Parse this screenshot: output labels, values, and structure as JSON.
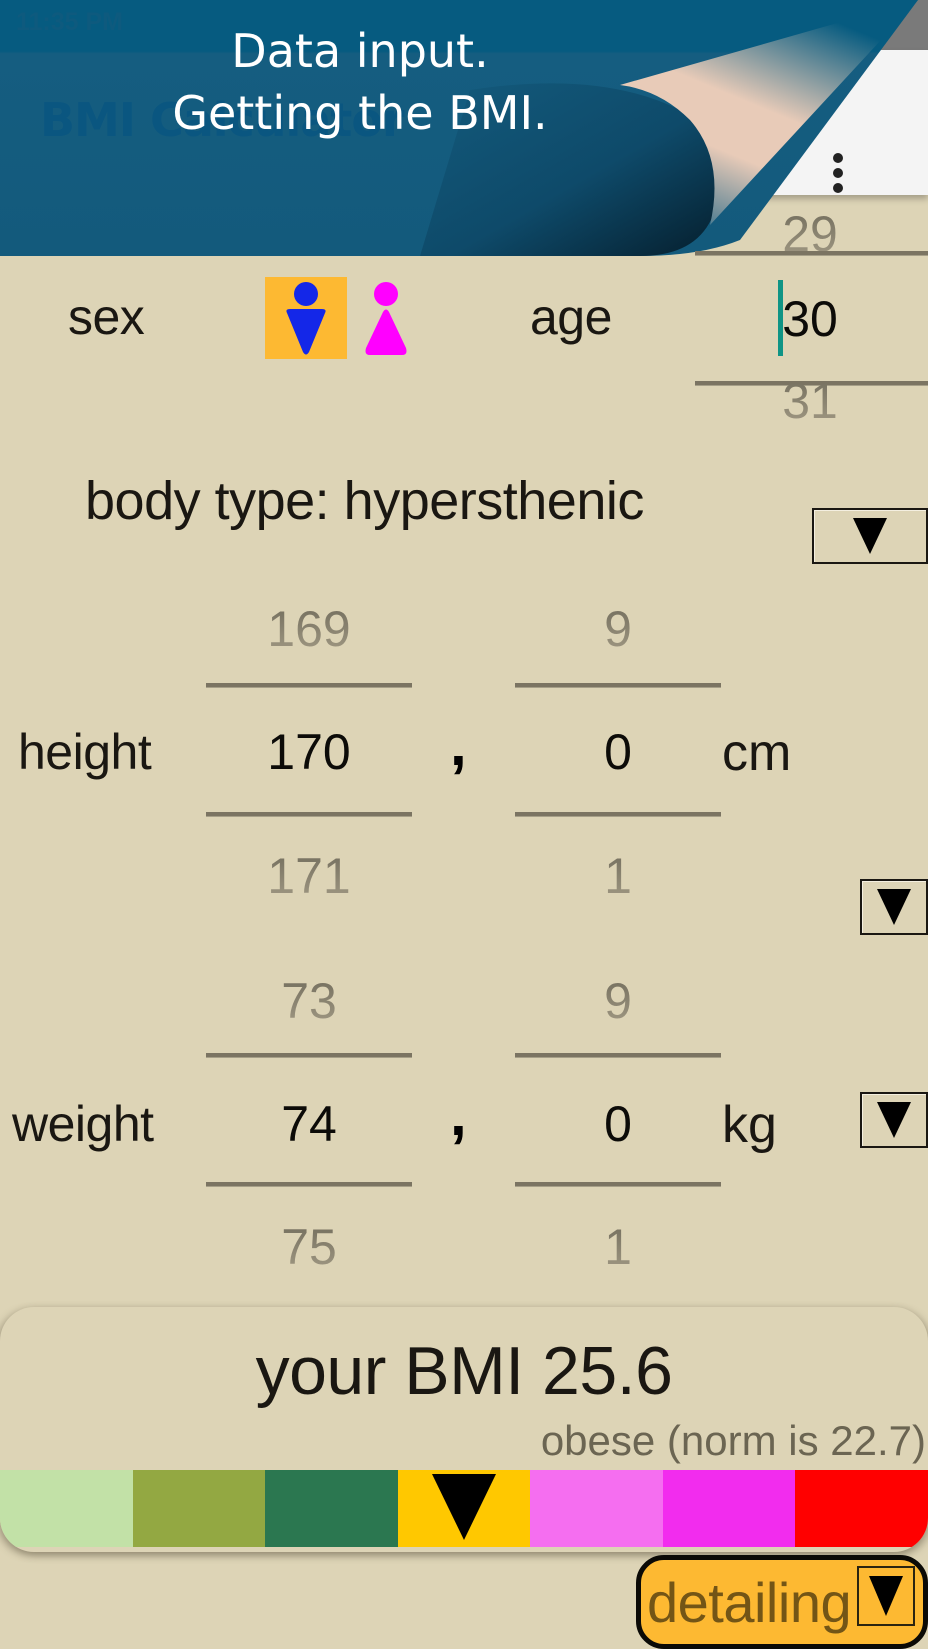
{
  "status_bar": {
    "time": "11:35 PM"
  },
  "app_bar": {
    "title": "BMI Calculator",
    "menu_icon": "more-vert-icon"
  },
  "banner": {
    "line1": "Data input.",
    "line2": "Getting the BMI."
  },
  "sex": {
    "label": "sex",
    "options": [
      {
        "name": "male",
        "icon": "male-icon",
        "selected": true,
        "color": "#1427e8"
      },
      {
        "name": "female",
        "icon": "female-icon",
        "selected": false,
        "color": "#ff00ff"
      }
    ],
    "selected_bg": "#fdb932"
  },
  "age": {
    "label": "age",
    "prev": "29",
    "value": "30",
    "next": "31"
  },
  "body_type": {
    "label": "body type: hypersthenic",
    "dropdown_icon": "triangle-down-icon"
  },
  "height": {
    "label": "height",
    "integer": {
      "prev": "169",
      "value": "170",
      "next": "171"
    },
    "separator": ",",
    "decimal": {
      "prev": "9",
      "value": "0",
      "next": "1"
    },
    "unit": "cm"
  },
  "weight": {
    "label": "weight",
    "integer": {
      "prev": "73",
      "value": "74",
      "next": "75"
    },
    "separator": ",",
    "decimal": {
      "prev": "9",
      "value": "0",
      "next": "1"
    },
    "unit": "kg"
  },
  "result": {
    "bmi_text": "your BMI 25.6",
    "bmi": 25.6,
    "status_text": "obese (norm is 22.7)",
    "scale_colors": [
      "#c2e1a7",
      "#93a842",
      "#2b7750",
      "#ffc800",
      "#f56ef0",
      "#f22cee",
      "#ff0000"
    ],
    "active_segment": 3
  },
  "detail_button": {
    "label": "detailing"
  }
}
